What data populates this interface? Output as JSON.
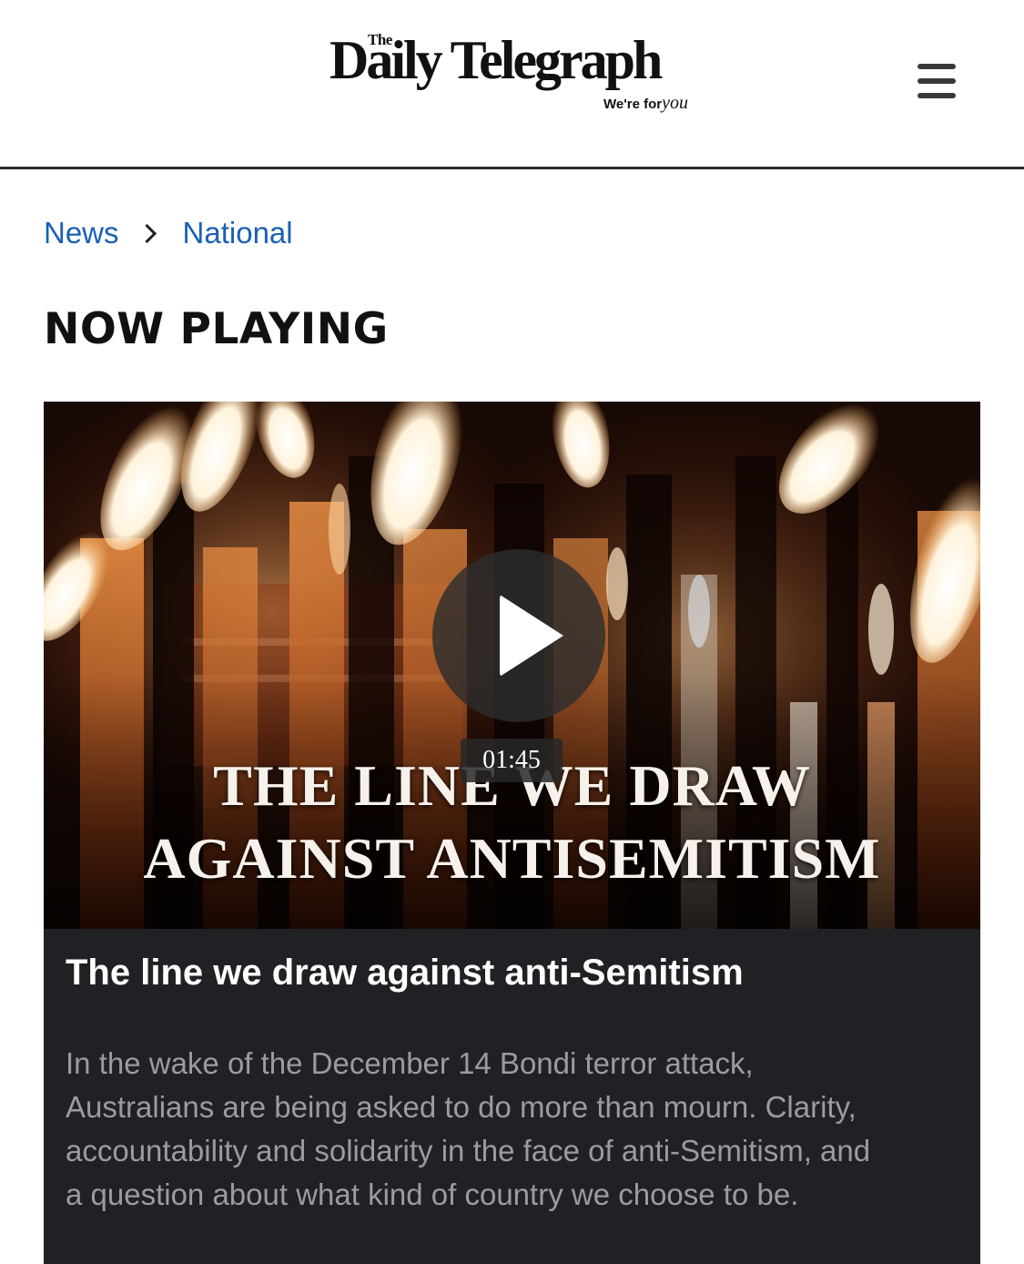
{
  "header": {
    "logo_the": "The",
    "logo_name": "Daily Telegraph",
    "logo_tagline": "We're for",
    "logo_tagline_script": "you",
    "menu_icon": "hamburger-menu-icon"
  },
  "breadcrumb": {
    "items": [
      {
        "label": "News"
      },
      {
        "label": "National"
      }
    ],
    "separator_icon": "chevron-right-icon"
  },
  "section_title": "NOW PLAYING",
  "video": {
    "overlay_line1": "THE LINE WE DRAW",
    "overlay_line2": "AGAINST ANTISEMITISM",
    "duration": "01:45",
    "play_icon": "play-icon",
    "title": "The line we draw against anti-Semitism",
    "description": "In the wake of the December 14 Bondi terror attack, Australians are being asked to do more than mourn. Clarity, accountability and solidarity in the face of anti-Semitism, and a question about what kind of country we choose to be."
  },
  "colors": {
    "link": "#1a5fb4",
    "panel_bg": "#202124",
    "description_text": "#9a9ca1",
    "header_rule": "#2a2a2a"
  }
}
